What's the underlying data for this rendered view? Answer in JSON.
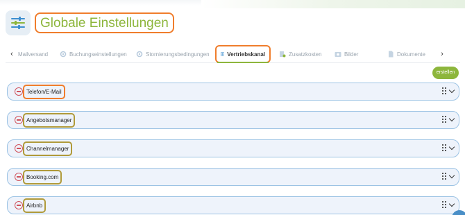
{
  "header": {
    "title": "Globale Einstellungen",
    "logo_icon": "sliders-icon"
  },
  "tabs": {
    "prev_icon": "‹",
    "items": [
      {
        "label": "Mailversand",
        "icon": ""
      },
      {
        "label": "Buchungseinstellungen",
        "icon": "gear-icon"
      },
      {
        "label": "Stornierungsbedingungen",
        "icon": "gear-icon"
      },
      {
        "label": "Vertriebskanal",
        "icon": "grid-icon",
        "active": true
      },
      {
        "label": "Zusatzkosten",
        "icon": "cost-icon"
      },
      {
        "label": "Bilder",
        "icon": "camera-icon"
      },
      {
        "label": "Dokumente",
        "icon": "document-icon"
      }
    ]
  },
  "actions": {
    "create_label": "erstellen"
  },
  "channels": [
    {
      "label": "Telefon/E-Mail",
      "highlight": "#f07d2c"
    },
    {
      "label": "Angebotsmanager",
      "highlight": "#b09a3a"
    },
    {
      "label": "Channelmanager",
      "highlight": "#b09a3a"
    },
    {
      "label": "Booking.com",
      "highlight": "#b09a3a"
    },
    {
      "label": "Airbnb",
      "highlight": "#b09a3a"
    }
  ],
  "colors": {
    "accent": "#8db63c",
    "highlight": "#f07d2c",
    "row_border": "#9cc3e4",
    "remove": "#d0525c"
  }
}
